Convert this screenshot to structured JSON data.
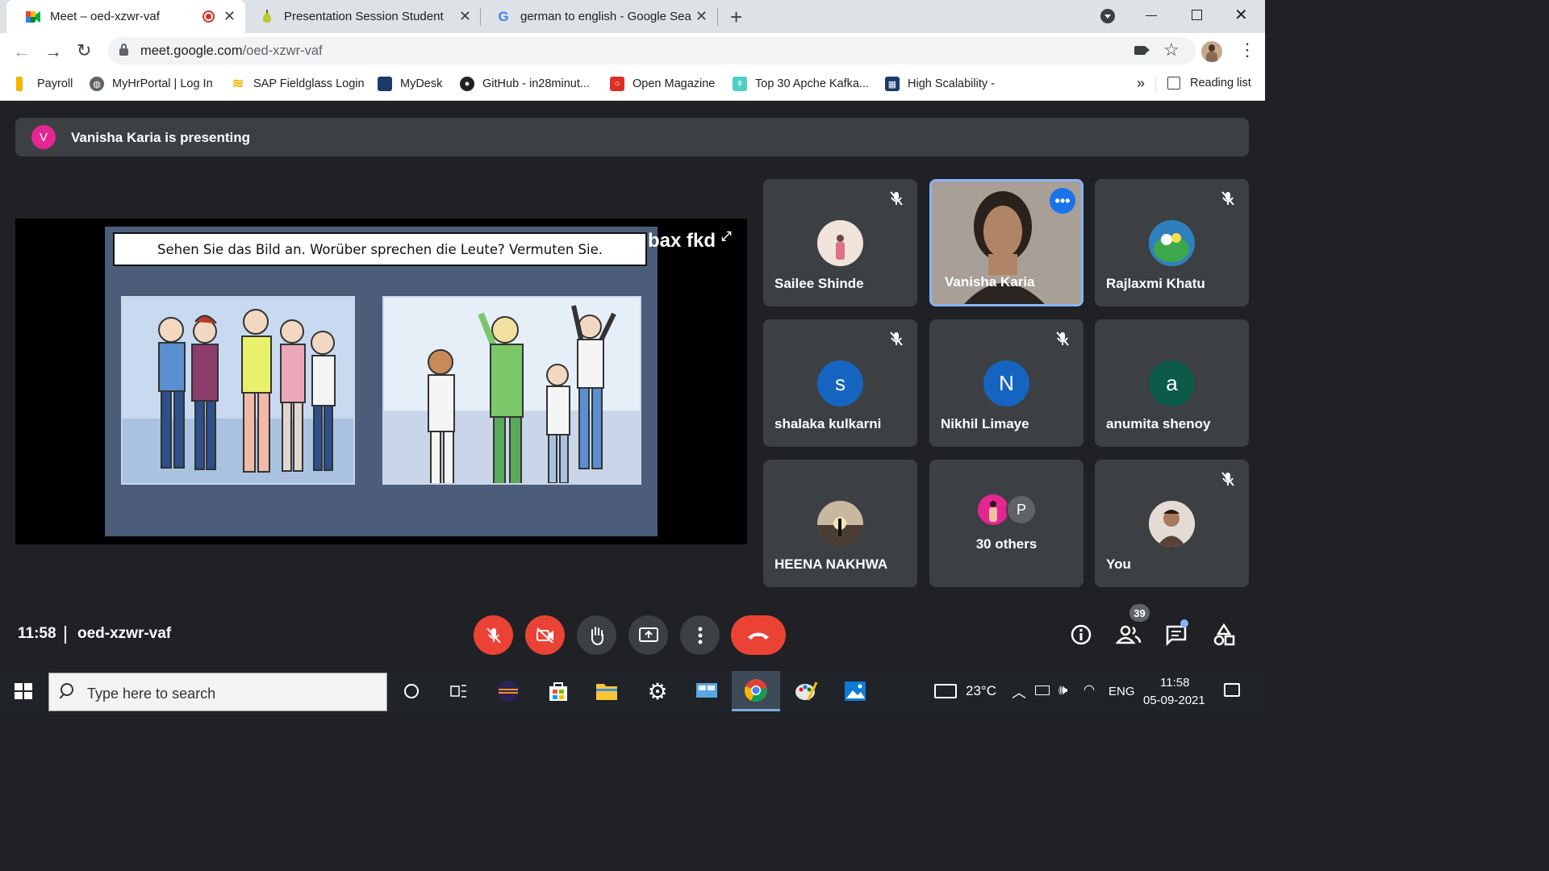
{
  "browser": {
    "tabs": [
      {
        "title": "Meet – oed-xzwr-vaf",
        "favicon": "google-meet-icon"
      },
      {
        "title": "Presentation Session Student",
        "favicon": "pear-icon"
      },
      {
        "title": "german to english - Google Search",
        "favicon": "google-icon"
      }
    ],
    "new_tab_label": "+",
    "url_host": "meet.google.com",
    "url_path": "/oed-xzwr-vaf",
    "bookmarks": [
      {
        "label": "Payroll",
        "icon": "payroll-icon",
        "color": "#f4b400"
      },
      {
        "label": "MyHrPortal | Log In",
        "icon": "globe-icon",
        "color": "#5f6368"
      },
      {
        "label": "SAP Fieldglass Login",
        "icon": "fieldglass-icon",
        "color": "#f4b400"
      },
      {
        "label": "MyDesk",
        "icon": "mydesk-icon",
        "color": "#1a3a6b"
      },
      {
        "label": "GitHub - in28minut...",
        "icon": "github-icon",
        "color": "#202124"
      },
      {
        "label": "Open Magazine",
        "icon": "open-magazine-icon",
        "color": "#d93025"
      },
      {
        "label": "Top 30 Apche Kafka...",
        "icon": "kafka-icon",
        "color": "#4dd0c4"
      },
      {
        "label": "High Scalability -",
        "icon": "high-scalability-icon",
        "color": "#1a3a6b"
      }
    ],
    "more_bookmarks": "»",
    "reading_list": "Reading list"
  },
  "meet": {
    "presenter_avatar_letter": "V",
    "banner_text": "Vanisha Karia is presenting",
    "slide_title": "Sehen Sie das Bild an. Worüber sprechen die Leute? Vermuten Sie.",
    "stage_label": "bax fkd",
    "participants": [
      {
        "name": "Sailee Shinde",
        "muted": true,
        "avatar_letter": "",
        "avatar_color": "#e8d8d0"
      },
      {
        "name": "Vanisha Karia",
        "muted": false,
        "avatar_letter": "",
        "avatar_color": "#9a8f86"
      },
      {
        "name": "Rajlaxmi Khatu",
        "muted": true,
        "avatar_letter": "",
        "avatar_color": "#3d9a4a"
      },
      {
        "name": "shalaka kulkarni",
        "muted": true,
        "avatar_letter": "s",
        "avatar_color": "#1565c0"
      },
      {
        "name": "Nikhil Limaye",
        "muted": true,
        "avatar_letter": "N",
        "avatar_color": "#1565c0"
      },
      {
        "name": "anumita shenoy",
        "muted": false,
        "avatar_letter": "a",
        "avatar_color": "#0b5a4a"
      },
      {
        "name": "HEENA NAKHWA",
        "muted": false,
        "avatar_letter": "",
        "avatar_color": "#6b5e52"
      },
      {
        "name": "30 others",
        "muted": false,
        "avatar_letter": "P",
        "avatar_color": "#5f6368"
      },
      {
        "name": "You",
        "muted": true,
        "avatar_letter": "",
        "avatar_color": "#c8b8a8"
      }
    ],
    "time": "11:58",
    "meeting_code": "oed-xzwr-vaf",
    "people_count": "39",
    "controls": [
      "mic-off-icon",
      "camera-off-icon",
      "raise-hand-icon",
      "present-icon",
      "more-options-icon",
      "end-call-icon"
    ]
  },
  "taskbar": {
    "search_placeholder": "Type here to search",
    "temperature": "23°C",
    "language": "ENG",
    "time": "11:58",
    "date": "05-09-2021"
  }
}
